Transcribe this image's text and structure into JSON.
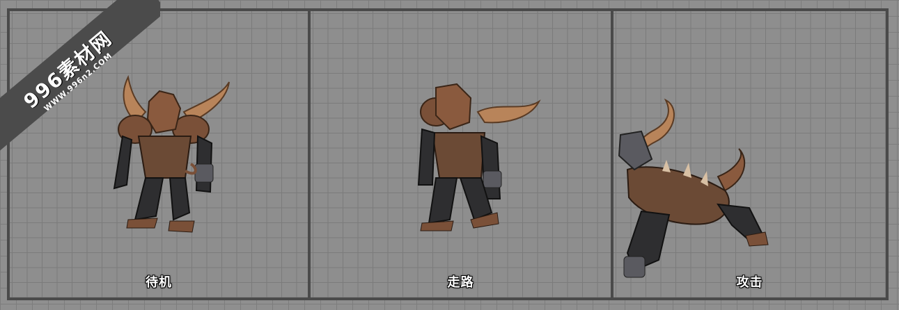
{
  "panels": [
    {
      "id": "idle",
      "label": "待机"
    },
    {
      "id": "walk",
      "label": "走路"
    },
    {
      "id": "attack",
      "label": "攻击"
    }
  ],
  "watermark": {
    "main": "996素材网",
    "url": "WWW.996n2.COM"
  },
  "colors": {
    "grid_bg": "#8e8e8e",
    "grid_line": "#7b7b7b",
    "panel_border": "#4a4a4a",
    "horn": "#b8845a",
    "armor": "#6b4a35",
    "skin": "#2e2e30"
  },
  "icons": [
    "horned-demon-idle",
    "horned-demon-walk",
    "horned-demon-attack"
  ]
}
